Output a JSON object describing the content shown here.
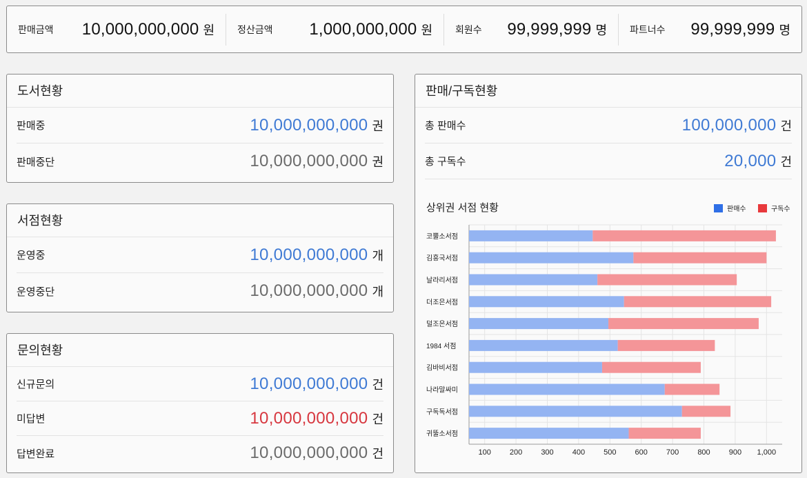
{
  "summary": [
    {
      "label": "판매금액",
      "value": "10,000,000,000",
      "unit": "원"
    },
    {
      "label": "정산금액",
      "value": "1,000,000,000",
      "unit": "원"
    },
    {
      "label": "회원수",
      "value": "99,999,999",
      "unit": "명"
    },
    {
      "label": "파트너수",
      "value": "99,999,999",
      "unit": "명"
    }
  ],
  "book": {
    "title": "도서현황",
    "rows": [
      {
        "label": "판매중",
        "value": "10,000,000,000",
        "unit": "권"
      },
      {
        "label": "판매중단",
        "value": "10,000,000,000",
        "unit": "권"
      }
    ]
  },
  "store": {
    "title": "서점현황",
    "rows": [
      {
        "label": "운영중",
        "value": "10,000,000,000",
        "unit": "개"
      },
      {
        "label": "운영중단",
        "value": "10,000,000,000",
        "unit": "개"
      }
    ]
  },
  "inquiry": {
    "title": "문의현황",
    "rows": [
      {
        "label": "신규문의",
        "value": "10,000,000,000",
        "unit": "건"
      },
      {
        "label": "미답변",
        "value": "10,000,000,000",
        "unit": "건"
      },
      {
        "label": "답변완료",
        "value": "10,000,000,000",
        "unit": "건"
      }
    ]
  },
  "sales": {
    "title": "판매/구독현황",
    "rows": [
      {
        "label": "총 판매수",
        "value": "100,000,000",
        "unit": "건"
      },
      {
        "label": "총 구독수",
        "value": "20,000",
        "unit": "건"
      }
    ],
    "chart_title": "상위권 서점 현황"
  },
  "colors": {
    "blue": "#3f7ad4",
    "gray": "#6b6b6b",
    "red": "#d7373f",
    "sales_bar": "#94b4f2",
    "sub_bar": "#f49598",
    "legend_sales": "#2f6fe6",
    "legend_sub": "#e8393c"
  },
  "chart_data": {
    "type": "bar",
    "orientation": "horizontal",
    "stacked": true,
    "categories": [
      "코뿔소서점",
      "김흥국서점",
      "날라리서점",
      "더조은서점",
      "덜조은서점",
      "1984 서점",
      "김바비서점",
      "나라말싸미",
      "구독독서점",
      "귀뚤소서점"
    ],
    "series": [
      {
        "name": "판매수",
        "values": [
          445,
          575,
          460,
          545,
          495,
          525,
          475,
          675,
          730,
          560
        ]
      },
      {
        "name": "구독수",
        "values": [
          585,
          425,
          445,
          470,
          480,
          310,
          315,
          175,
          155,
          230
        ]
      }
    ],
    "x_ticks": [
      "100",
      "200",
      "300",
      "400",
      "500",
      "600",
      "700",
      "800",
      "900",
      "1,000"
    ],
    "xlim": [
      50,
      1050
    ],
    "legend_position": "top-right",
    "grid": true
  }
}
